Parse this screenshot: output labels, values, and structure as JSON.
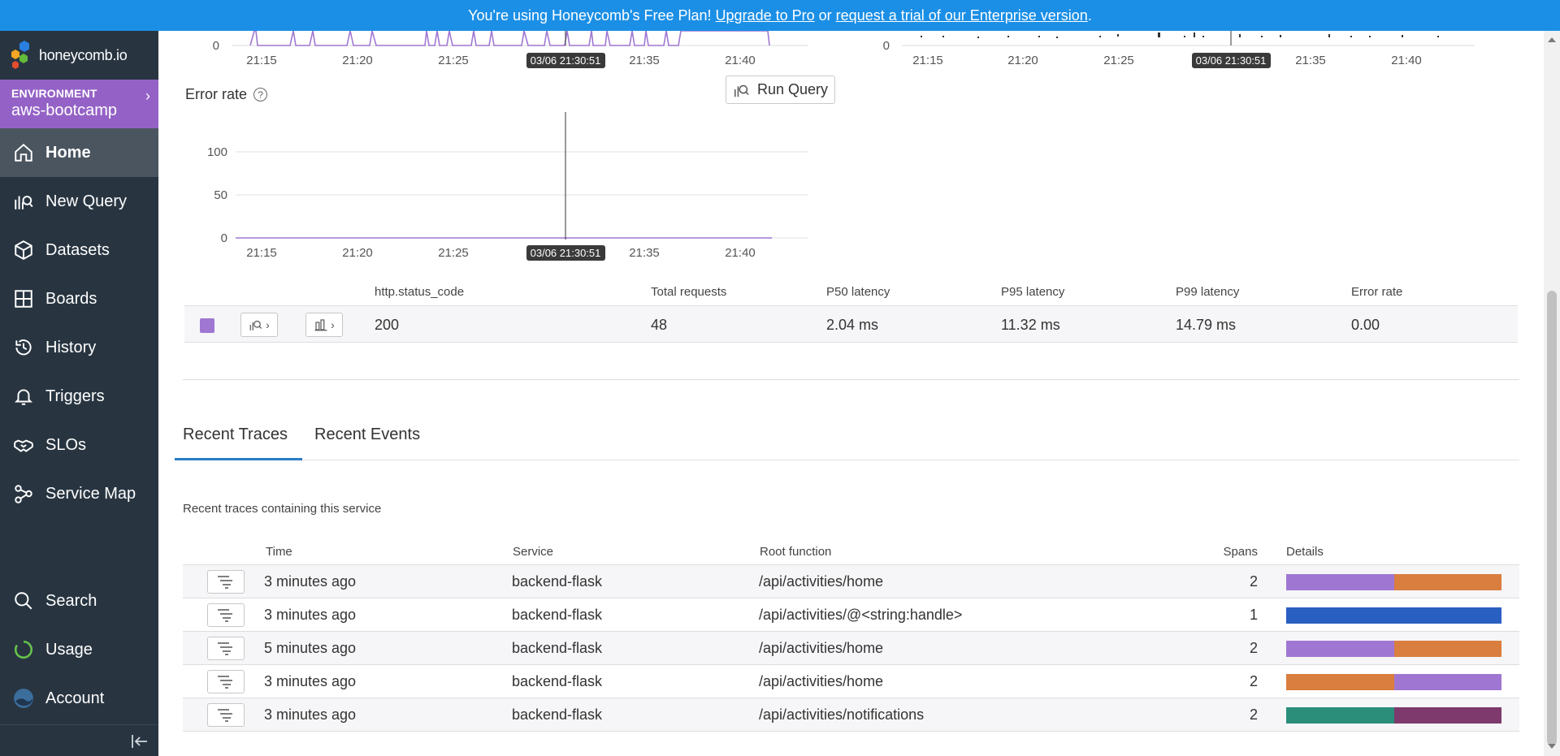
{
  "banner": {
    "prefix": "You're using Honeycomb's Free Plan! ",
    "upgrade_link": "Upgrade to Pro",
    "middle": " or ",
    "trial_link": "request a trial of our Enterprise version",
    "suffix": "."
  },
  "brand": {
    "logo_text": "honeycomb.io"
  },
  "environment": {
    "label": "ENVIRONMENT",
    "name": "aws-bootcamp"
  },
  "nav": {
    "items": [
      {
        "label": "Home",
        "icon": "home-icon",
        "active": true
      },
      {
        "label": "New Query",
        "icon": "new-query-icon"
      },
      {
        "label": "Datasets",
        "icon": "datasets-icon"
      },
      {
        "label": "Boards",
        "icon": "boards-icon"
      },
      {
        "label": "History",
        "icon": "history-icon"
      },
      {
        "label": "Triggers",
        "icon": "bell-icon"
      },
      {
        "label": "SLOs",
        "icon": "handshake-icon"
      },
      {
        "label": "Service Map",
        "icon": "service-map-icon"
      }
    ],
    "bottom": [
      {
        "label": "Search",
        "icon": "search-icon"
      },
      {
        "label": "Usage",
        "icon": "usage-icon"
      },
      {
        "label": "Account",
        "icon": "avatar"
      }
    ]
  },
  "colors": {
    "accent_purple": "#9f77d2",
    "banner_blue": "#1b8fe6",
    "sidebar_bg": "#283541",
    "tab_underline": "#2a7cc7"
  },
  "chart_data": [
    {
      "type": "line",
      "title": "",
      "x_ticks": [
        "21:15",
        "21:20",
        "21:25",
        "21:35",
        "21:40"
      ],
      "y_ticks": [
        "0"
      ],
      "cursor_label": "03/06 21:30:51"
    },
    {
      "type": "scatter",
      "title": "",
      "x_ticks": [
        "21:15",
        "21:20",
        "21:25",
        "21:35",
        "21:40"
      ],
      "y_ticks": [
        "0"
      ],
      "cursor_label": "03/06 21:30:51"
    },
    {
      "type": "line",
      "title": "Error rate",
      "x_ticks": [
        "21:15",
        "21:20",
        "21:25",
        "21:35",
        "21:40"
      ],
      "y_ticks": [
        "100",
        "50",
        "0"
      ],
      "ylim": [
        0,
        100
      ],
      "cursor_label": "03/06 21:30:51",
      "series": [
        {
          "name": "200",
          "values": [
            0,
            0,
            0,
            0,
            0,
            0
          ]
        }
      ]
    }
  ],
  "run_query": {
    "label": "Run Query"
  },
  "summary": {
    "headers": {
      "status": "http.status_code",
      "total": "Total requests",
      "p50": "P50 latency",
      "p95": "P95 latency",
      "p99": "P99 latency",
      "error": "Error rate"
    },
    "row": {
      "status": "200",
      "total": "48",
      "p50": "2.04 ms",
      "p95": "11.32 ms",
      "p99": "14.79 ms",
      "error": "0.00"
    }
  },
  "tabs": {
    "traces": "Recent Traces",
    "events": "Recent Events"
  },
  "traces": {
    "description": "Recent traces containing this service",
    "headers": {
      "time": "Time",
      "service": "Service",
      "root": "Root function",
      "spans": "Spans",
      "details": "Details"
    },
    "rows": [
      {
        "time": "3 minutes ago",
        "service": "backend-flask",
        "root": "/api/activities/home",
        "spans": "2",
        "bar": [
          [
            "#9f77d2",
            50
          ],
          [
            "#d97e3e",
            50
          ]
        ]
      },
      {
        "time": "3 minutes ago",
        "service": "backend-flask",
        "root": "/api/activities/@<string:handle>",
        "spans": "1",
        "bar": [
          [
            "#2a5fc2",
            100
          ]
        ]
      },
      {
        "time": "5 minutes ago",
        "service": "backend-flask",
        "root": "/api/activities/home",
        "spans": "2",
        "bar": [
          [
            "#9f77d2",
            50
          ],
          [
            "#d97e3e",
            50
          ]
        ]
      },
      {
        "time": "3 minutes ago",
        "service": "backend-flask",
        "root": "/api/activities/home",
        "spans": "2",
        "bar": [
          [
            "#d97e3e",
            50
          ],
          [
            "#9f77d2",
            50
          ]
        ]
      },
      {
        "time": "3 minutes ago",
        "service": "backend-flask",
        "root": "/api/activities/notifications",
        "spans": "2",
        "bar": [
          [
            "#2a8e7b",
            50
          ],
          [
            "#7e3a6c",
            50
          ]
        ]
      }
    ]
  }
}
